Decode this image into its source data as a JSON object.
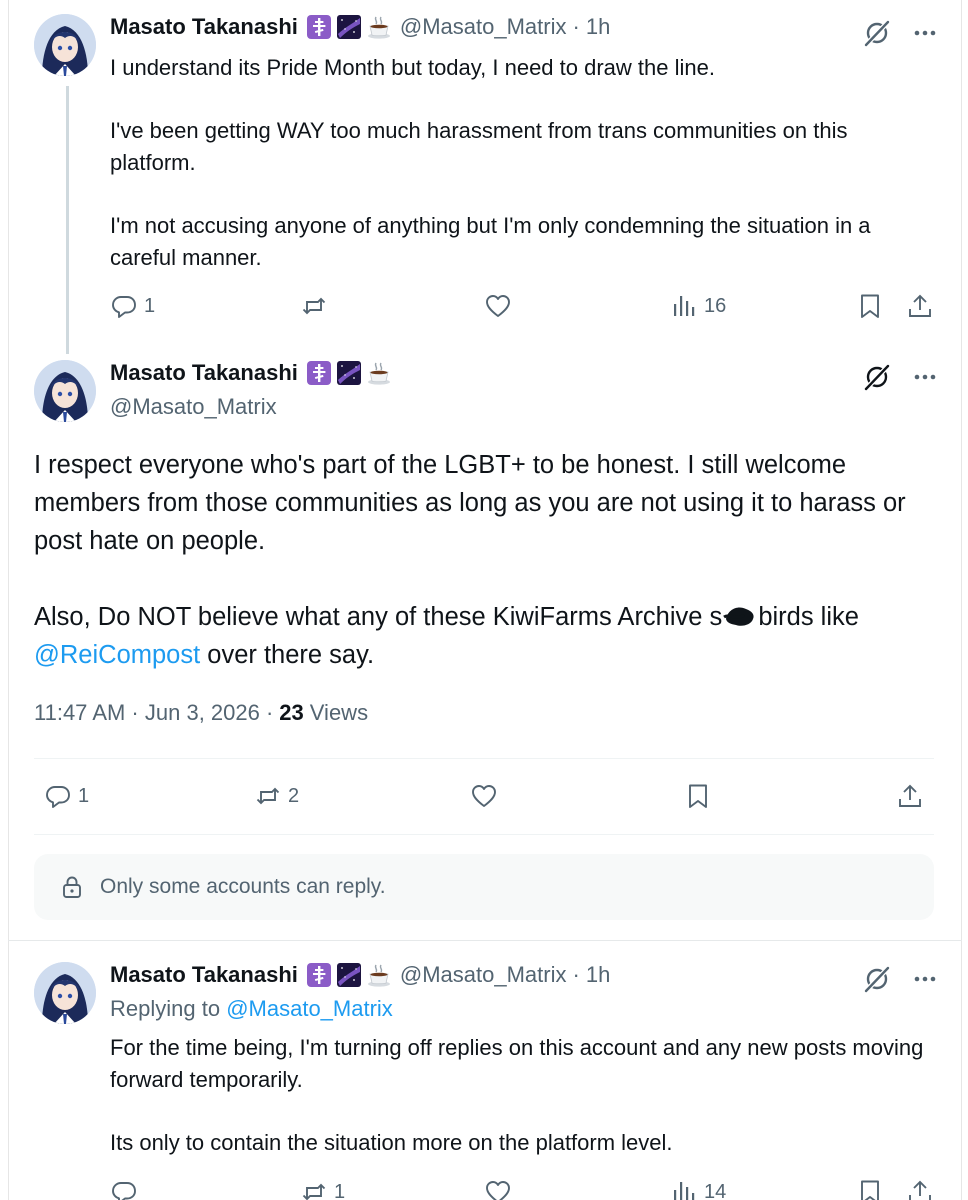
{
  "posts": [
    {
      "author": "Masato Takanashi",
      "handle": "@Masato_Matrix",
      "separator": "·",
      "time": "1h",
      "paragraphs": [
        "I understand its Pride Month but today, I need to draw the line.",
        "I've been getting WAY too much harassment from trans communities on this platform.",
        "I'm not accusing anyone of anything but I'm only condemning the situation in a careful manner."
      ],
      "actions": {
        "replies": "1",
        "reposts": "",
        "likes": "",
        "views": "16"
      }
    },
    {
      "author": "Masato Takanashi",
      "handle": "@Masato_Matrix",
      "paragraph1": "I respect everyone who's part of the LGBT+ to be honest. I still welcome members from those communities as long as you are not using it to harass or post hate on people.",
      "paragraph2_pre": "Also, Do NOT believe what any of these KiwiFarms Archive s",
      "paragraph2_mid": "birds like",
      "paragraph2_mention": "@ReiCompost",
      "paragraph2_post": " over there say.",
      "timestamp": "11:47 AM · Jun 3, 2026 ·",
      "views_count": "23",
      "views_label": "Views",
      "actions": {
        "replies": "1",
        "reposts": "2"
      },
      "reply_restriction": "Only some accounts can reply."
    },
    {
      "author": "Masato Takanashi",
      "handle": "@Masato_Matrix",
      "separator": "·",
      "time": "1h",
      "replying_prefix": "Replying to",
      "replying_to": "@Masato_Matrix",
      "paragraphs": [
        "For the time being, I'm turning off replies on this account and any new posts moving forward temporarily.",
        "Its only to contain the situation more on the platform level."
      ],
      "actions": {
        "replies": "",
        "reposts": "1",
        "likes": "",
        "views": "14"
      }
    }
  ],
  "icons": {
    "emoji": [
      "orthodox-cross-emoji",
      "milky-way-emoji",
      "hot-beverage-emoji"
    ],
    "top": [
      "grok-icon",
      "more-icon"
    ]
  },
  "colors": {
    "text": "#0f1419",
    "secondary": "#536471",
    "link": "#1d9bf0",
    "thread_line": "#cfd9de"
  }
}
